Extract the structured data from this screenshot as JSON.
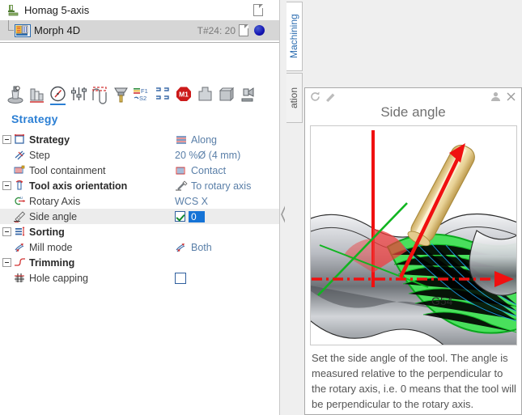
{
  "operation_tree": {
    "rows": [
      {
        "label": "Homag 5-axis",
        "meta": "",
        "icon": "machine-icon",
        "selected": false,
        "indent": 0
      },
      {
        "label": "Morph 4D",
        "meta": "T#24: 20",
        "icon": "morph-operation-icon",
        "selected": true,
        "indent": 1
      }
    ]
  },
  "toolbar": {
    "icons": [
      {
        "name": "tool-icon",
        "active": false
      },
      {
        "name": "stock-icon",
        "active": false
      },
      {
        "name": "strategy-gauge-icon",
        "active": true
      },
      {
        "name": "parameters-sliders-icon",
        "active": false
      },
      {
        "name": "toolpath-icon",
        "active": false
      },
      {
        "name": "holder-icon",
        "active": false
      },
      {
        "name": "feeds-speeds-icon",
        "active": false
      },
      {
        "name": "links-grid-icon",
        "active": false
      },
      {
        "name": "m1-stop-icon",
        "active": false
      },
      {
        "name": "roughing-icon",
        "active": false
      },
      {
        "name": "stock-block-icon",
        "active": false
      },
      {
        "name": "machine-sim-icon",
        "active": false
      }
    ]
  },
  "section_title": "Strategy",
  "parameters": [
    {
      "label": "Strategy",
      "value": "Along",
      "group": true,
      "expander": true,
      "icon": "strategy-icon",
      "value_icon": "along-icon",
      "selected": false,
      "type": "text"
    },
    {
      "label": "Step",
      "value": "20 %Ø (4 mm)",
      "group": false,
      "expander": false,
      "icon": "step-icon",
      "value_icon": "",
      "selected": false,
      "type": "text"
    },
    {
      "label": "Tool containment",
      "value": "Contact",
      "group": false,
      "expander": false,
      "icon": "containment-icon",
      "value_icon": "contact-icon",
      "selected": false,
      "type": "text"
    },
    {
      "label": "Tool axis orientation",
      "value": "To rotary axis",
      "group": true,
      "expander": true,
      "icon": "tool-axis-icon",
      "value_icon": "rotary-axis-value-icon",
      "selected": false,
      "type": "text"
    },
    {
      "label": "Rotary Axis",
      "value": "WCS X",
      "group": false,
      "expander": false,
      "icon": "rotary-axis-icon",
      "value_icon": "",
      "selected": false,
      "type": "text"
    },
    {
      "label": "Side angle",
      "value": "0",
      "group": false,
      "expander": false,
      "icon": "side-angle-icon",
      "value_icon": "",
      "selected": true,
      "type": "checkbox-number",
      "checked": true
    },
    {
      "label": "Sorting",
      "value": "",
      "group": true,
      "expander": true,
      "icon": "sorting-icon",
      "value_icon": "",
      "selected": false,
      "type": "text"
    },
    {
      "label": "Mill mode",
      "value": "Both",
      "group": false,
      "expander": false,
      "icon": "mill-mode-icon",
      "value_icon": "mill-mode-value-icon",
      "selected": false,
      "type": "text"
    },
    {
      "label": "Trimming",
      "value": "",
      "group": true,
      "expander": true,
      "icon": "trimming-icon",
      "value_icon": "",
      "selected": false,
      "type": "text"
    },
    {
      "label": "Hole capping",
      "value": "",
      "group": false,
      "expander": false,
      "icon": "hole-capping-icon",
      "value_icon": "",
      "selected": false,
      "type": "checkbox",
      "checked": false
    }
  ],
  "tabs": {
    "machining": "Machining",
    "simulation": "ation"
  },
  "popup": {
    "title": "Side angle",
    "help_text": "Set the side angle of the tool. The angle is measured relative to the perpendicular to the rotary axis, i.e. 0 means that the tool will be perpendicular to the rotary axis.",
    "icons": {
      "refresh": "refresh-icon",
      "edit": "pencil-edit-icon",
      "person": "user-icon",
      "close": "close-icon"
    },
    "image": {
      "annotation": "G54",
      "description": "3d-tool-side-angle-illustration"
    }
  },
  "colors": {
    "accent_blue": "#2b7fd4",
    "value_blue": "#5a7fa8",
    "selection_gray": "#d6d6d6",
    "row_highlight": "#ececec",
    "edit_blue": "#1573d6"
  }
}
